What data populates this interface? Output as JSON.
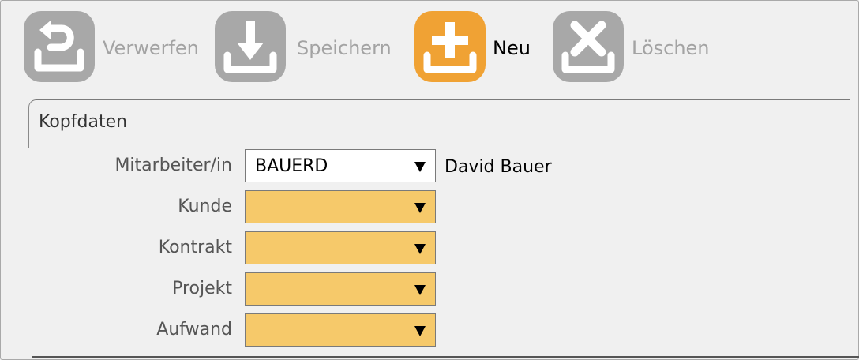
{
  "toolbar": {
    "buttons": [
      {
        "label": "Verwerfen",
        "icon": "undo-icon",
        "enabled": false
      },
      {
        "label": "Speichern",
        "icon": "save-download-icon",
        "enabled": false
      },
      {
        "label": "Neu",
        "icon": "plus-icon",
        "enabled": true
      },
      {
        "label": "Löschen",
        "icon": "delete-x-icon",
        "enabled": false
      }
    ]
  },
  "group": {
    "title": "Kopfdaten"
  },
  "form": {
    "employee": {
      "label": "Mitarbeiter/in",
      "value": "BAUERD",
      "display_name": "David Bauer"
    },
    "customer": {
      "label": "Kunde",
      "value": ""
    },
    "contract": {
      "label": "Kontrakt",
      "value": ""
    },
    "project": {
      "label": "Projekt",
      "value": ""
    },
    "effort": {
      "label": "Aufwand",
      "value": ""
    }
  },
  "colors": {
    "required_field_bg": "#f6c96a",
    "active_button": "#f0a234",
    "disabled_button": "#a8a8a8"
  }
}
